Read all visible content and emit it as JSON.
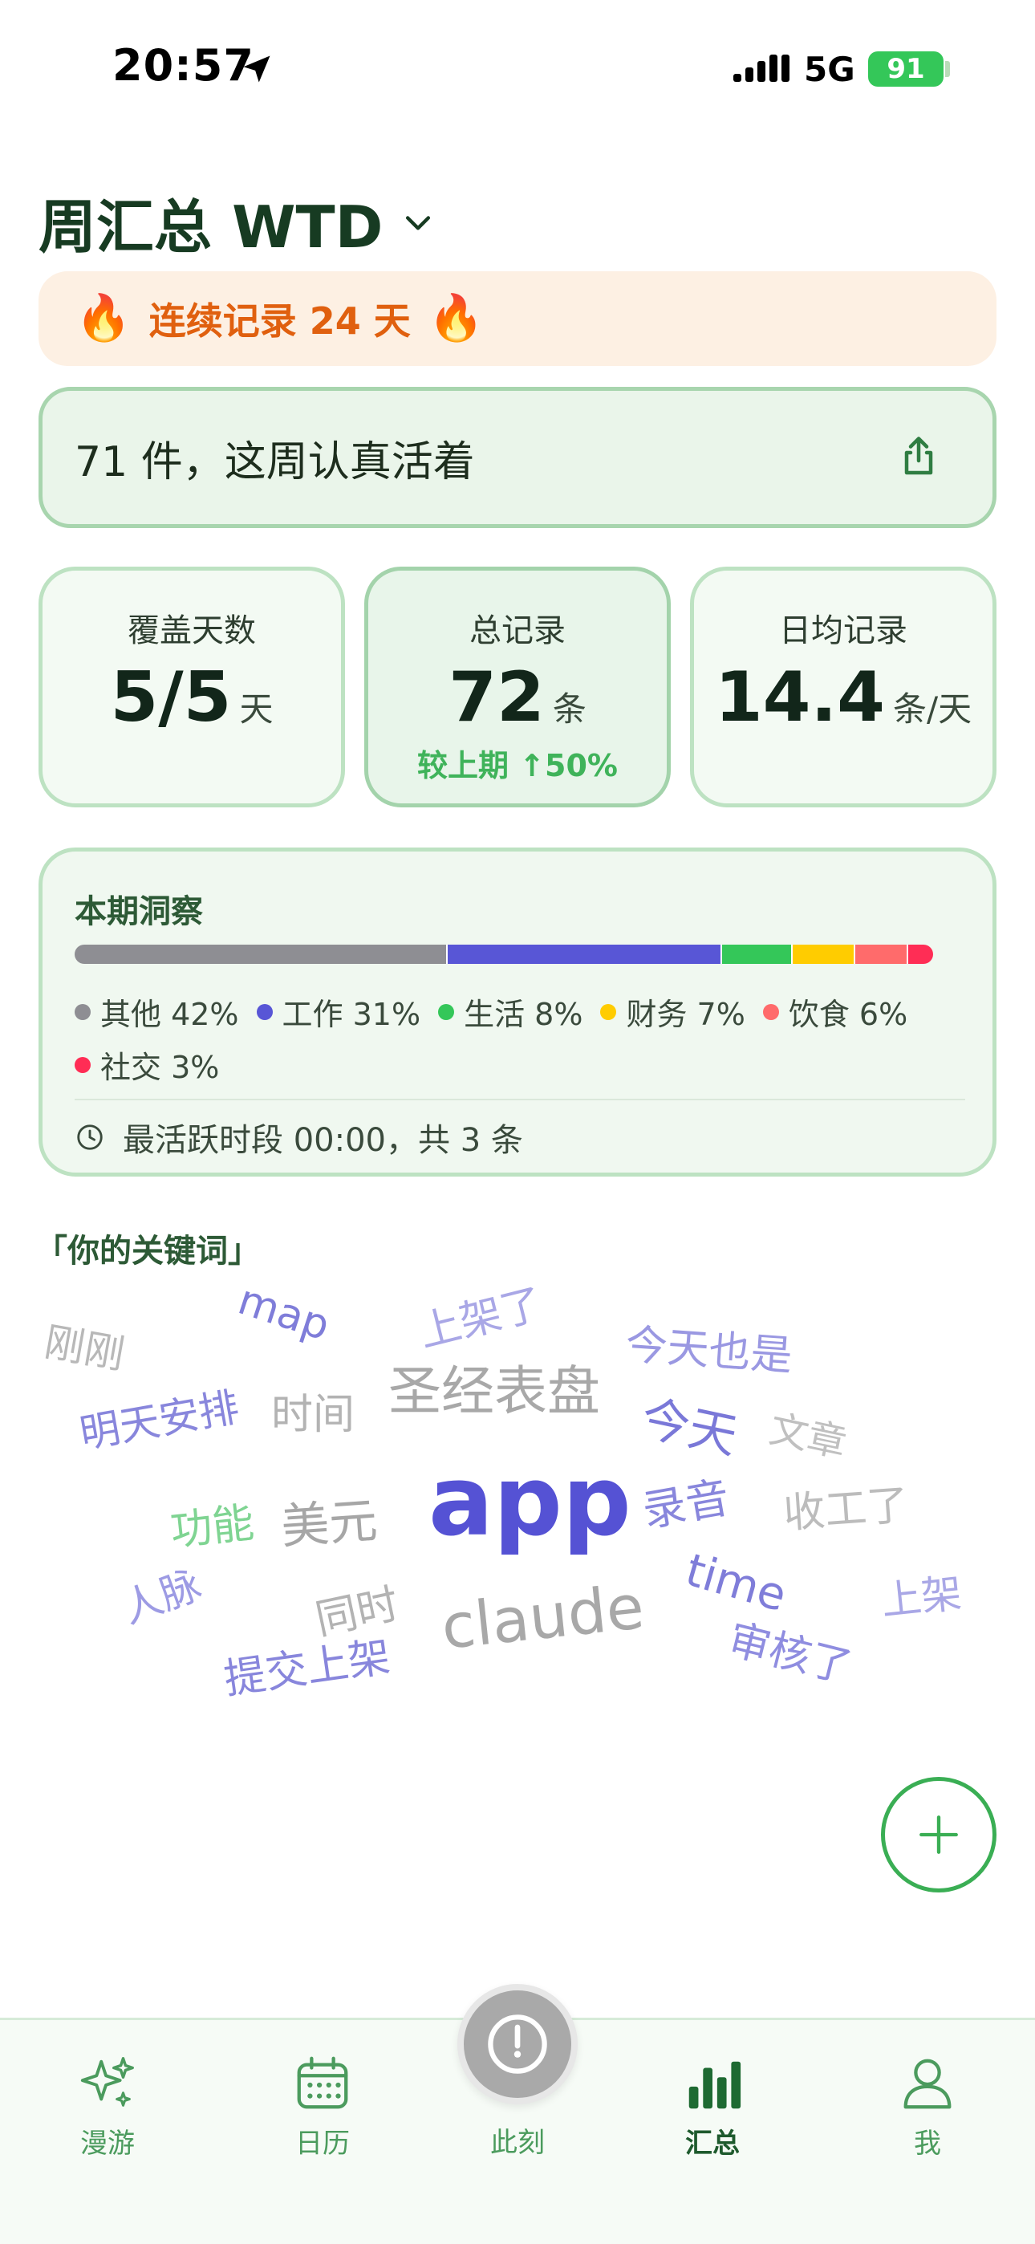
{
  "status_bar": {
    "time": "20:57",
    "network": "5G",
    "battery": "91"
  },
  "header": {
    "title": "周汇总 WTD"
  },
  "streak": {
    "text": "连续记录 24 天",
    "icon_left": "🔥",
    "icon_right": "🔥"
  },
  "summary": {
    "text": "71 件，这周认真活着"
  },
  "stats": [
    {
      "label": "覆盖天数",
      "value": "5/5",
      "unit": "天"
    },
    {
      "label": "总记录",
      "value": "72",
      "unit": "条",
      "delta": "较上期 ↑50%"
    },
    {
      "label": "日均记录",
      "value": "14.4",
      "unit": "条/天"
    }
  ],
  "insight": {
    "title": "本期洞察",
    "segments": [
      {
        "label": "其他 42%",
        "percent": 42,
        "color": "#8e8e93"
      },
      {
        "label": "工作 31%",
        "percent": 31,
        "color": "#5856d6"
      },
      {
        "label": "生活 8%",
        "percent": 8,
        "color": "#34c759"
      },
      {
        "label": "财务 7%",
        "percent": 7,
        "color": "#ffcc00"
      },
      {
        "label": "饮食 6%",
        "percent": 6,
        "color": "#ff6b6b"
      },
      {
        "label": "社交 3%",
        "percent": 3,
        "color": "#ff2d55"
      }
    ],
    "active_period": "最活跃时段 00:00，共 3 条"
  },
  "keywords": {
    "title": "「你的关键词」",
    "words": [
      "刚刚",
      "map",
      "上架了",
      "圣经表盘",
      "今天也是",
      "明天安排",
      "时间",
      "今天",
      "文章",
      "功能",
      "美元",
      "app",
      "录音",
      "收工了",
      "人脉",
      "同时",
      "time",
      "上架",
      "claude",
      "审核了",
      "提交上架"
    ]
  },
  "tabbar": {
    "items": [
      {
        "label": "漫游"
      },
      {
        "label": "日历"
      },
      {
        "label": "此刻"
      },
      {
        "label": "汇总"
      },
      {
        "label": "我"
      }
    ]
  },
  "colors": {
    "accent": "#3aae54",
    "streak_text": "#e0600f"
  }
}
